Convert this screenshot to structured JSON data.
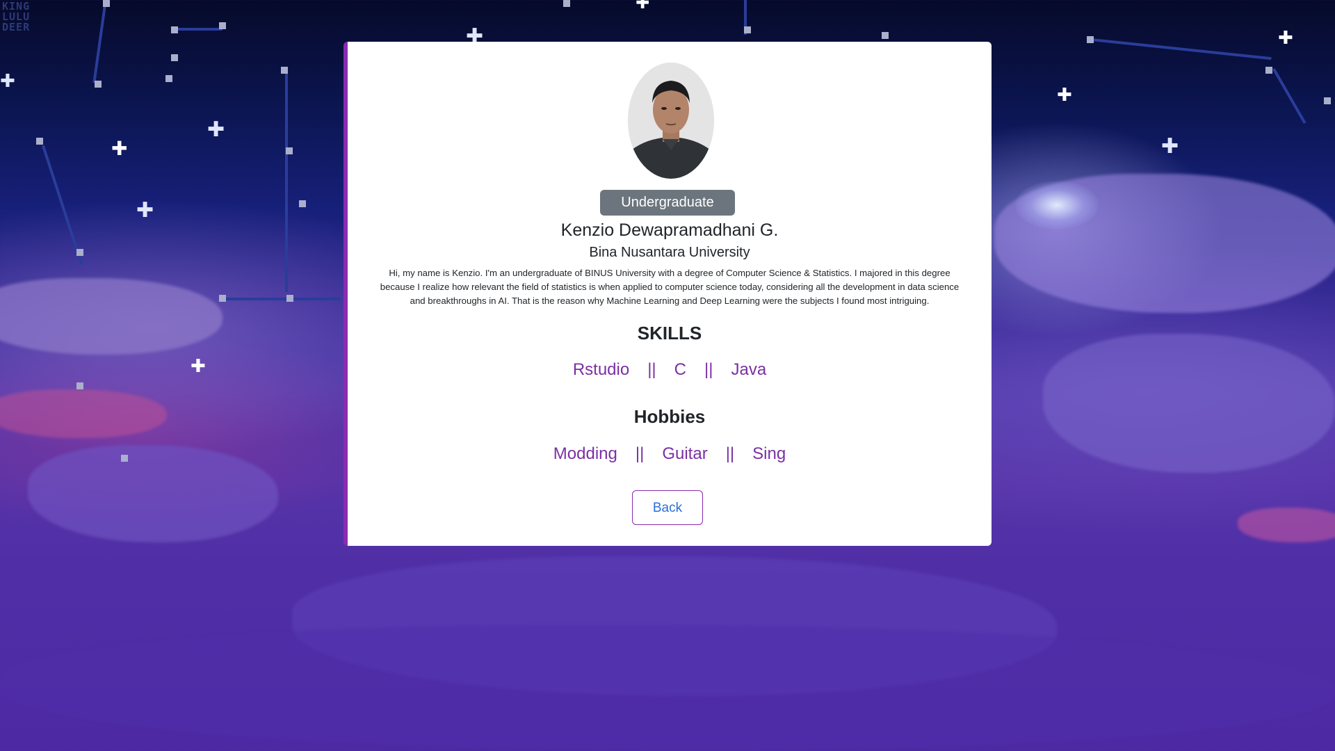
{
  "background": {
    "watermark_lines": [
      "KING",
      "LULU",
      "DEER"
    ]
  },
  "profile": {
    "status_badge": "Undergraduate",
    "name": "Kenzio Dewapramadhani G.",
    "university": "Bina Nusantara University",
    "bio": "Hi, my name is Kenzio. I'm an undergraduate of BINUS University with a degree of Computer Science & Statistics. I majored in this degree because I realize how relevant the field of statistics is when applied to computer science today, considering all the development in data science and breakthroughs in AI. That is the reason why Machine Learning and Deep Learning were the subjects I found most intriguing."
  },
  "skills": {
    "title": "SKILLS",
    "items": [
      "Rstudio",
      "C",
      "Java"
    ],
    "separator": "||"
  },
  "hobbies": {
    "title": "Hobbies",
    "items": [
      "Modding",
      "Guitar",
      "Sing"
    ],
    "separator": "||"
  },
  "actions": {
    "back_label": "Back"
  },
  "colors": {
    "accent_purple": "#7b2fa3",
    "badge_gray": "#6c757d",
    "link_blue": "#2a6edc"
  }
}
